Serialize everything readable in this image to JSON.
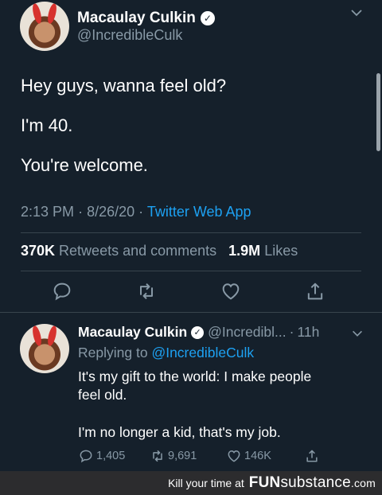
{
  "main_tweet": {
    "author_name": "Macaulay Culkin",
    "author_handle": "@IncredibleCulk",
    "avatar_tag": "SS",
    "lines": [
      "Hey guys, wanna feel old?",
      "I'm 40.",
      "You're welcome."
    ],
    "time": "2:13 PM",
    "sep1": "·",
    "date": "8/26/20",
    "sep2": "·",
    "source": "Twitter Web App",
    "retweets_count": "370K",
    "retweets_label": "Retweets and comments",
    "likes_count": "1.9M",
    "likes_label": "Likes"
  },
  "reply_tweet": {
    "author_name": "Macaulay Culkin",
    "author_handle": "@Incredibl...",
    "sep": "·",
    "age": "11h",
    "avatar_tag": "SS",
    "replying_prefix": "Replying to",
    "replying_handle": "@IncredibleCulk",
    "line1": "It's my gift to the world: I make people",
    "line2": "feel old.",
    "line3": "I'm no longer a kid, that's my job.",
    "replies": "1,405",
    "retweets": "9,691",
    "likes": "146K"
  },
  "footer": {
    "tagline": "Kill your time at",
    "brand_fun": "FUN",
    "brand_substance": "substance",
    "brand_tld": ".com"
  },
  "icons": {
    "verified": "check-badge-icon",
    "menu": "chevron-down-icon",
    "reply": "speech-bubble-icon",
    "retweet": "retweet-arrows-icon",
    "like": "heart-icon",
    "share": "share-upload-icon"
  },
  "colors": {
    "background": "#15202b",
    "text": "#ffffff",
    "muted": "#8899a6",
    "link": "#1da1f2",
    "divider": "#38444d",
    "footer_bg": "#2c2c2e"
  }
}
